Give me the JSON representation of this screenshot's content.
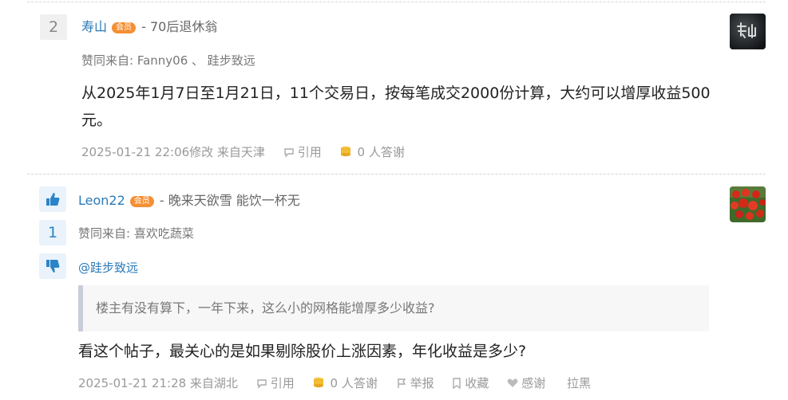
{
  "posts": [
    {
      "floor": "2",
      "author": "寿山",
      "badge": "会员",
      "signature": "- 70后退休翁",
      "liked_from": "赞同来自:  Fanny06  、 跬步致远",
      "content": "从2025年1月7日至1月21日，11个交易日，按每笔成交2000份计算，大约可以增厚收益500元。",
      "timestamp": "2025-01-21 22:06修改 来自天津",
      "actions": {
        "quote": "引用",
        "thanks_count": "0 人答谢"
      }
    },
    {
      "votes": "1",
      "author": "Leon22",
      "badge": "会员",
      "signature": "- 晚来天欲雪 能饮一杯无",
      "liked_from": "赞同来自:  喜欢吃蔬菜",
      "mention": "@跬步致远",
      "quote_text": "楼主有没有算下，一年下来，这么小的网格能增厚多少收益?",
      "content": "看这个帖子，最关心的是如果剔除股价上涨因素，年化收益是多少?",
      "timestamp": "2025-01-21 21:28 来自湖北",
      "actions": {
        "quote": "引用",
        "thanks_count": "0 人答谢",
        "report": "举报",
        "favorite": "收藏",
        "thank": "感谢",
        "block": "拉黑"
      }
    }
  ],
  "colors": {
    "link": "#2a7ab8",
    "badge": "#f58f33",
    "meta": "#999999",
    "vote_bg": "#eaf3fb"
  }
}
